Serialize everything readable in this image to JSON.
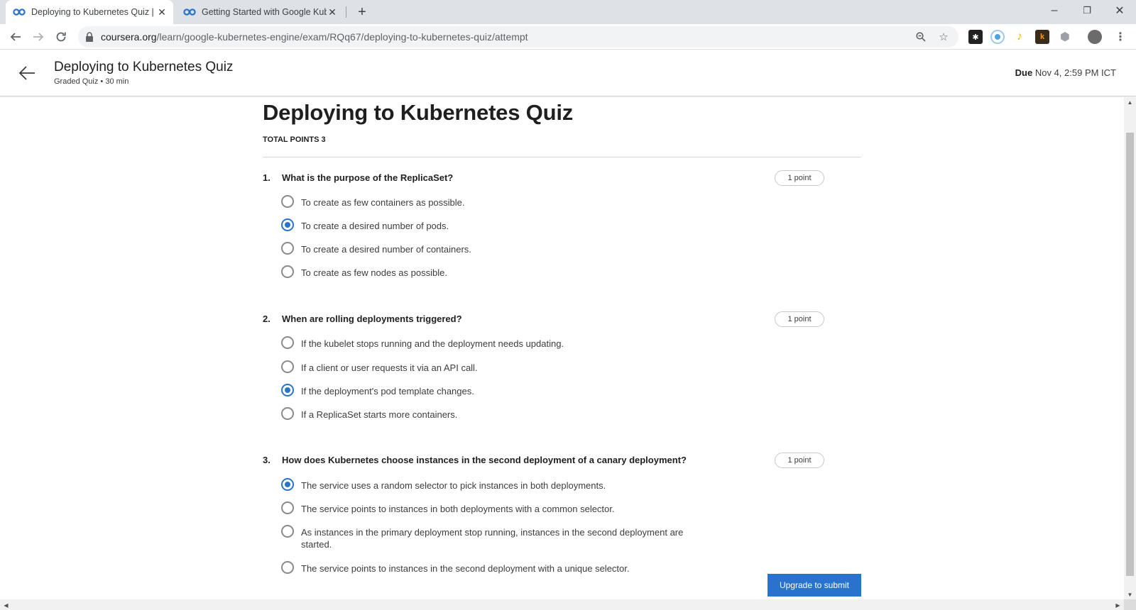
{
  "browser": {
    "tabs": [
      {
        "title": "Deploying to Kubernetes Quiz | C",
        "active": true
      },
      {
        "title": "Getting Started with Google Kub",
        "active": false
      }
    ],
    "url_host": "coursera.org",
    "url_path": "/learn/google-kubernetes-engine/exam/RQq67/deploying-to-kubernetes-quiz/attempt",
    "window_controls": {
      "minimize": "–",
      "restore": "❐",
      "close": "✕"
    },
    "extensions": [
      "ext-dark",
      "ext-blue-circle",
      "ext-yellow-key",
      "ext-orange-k",
      "ext-gray-hex"
    ]
  },
  "header": {
    "title": "Deploying to Kubernetes Quiz",
    "subtitle": "Graded Quiz • 30 min",
    "due_label": "Due",
    "due_value": "Nov 4, 2:59 PM ICT"
  },
  "quiz": {
    "title": "Deploying to Kubernetes Quiz",
    "total_points": "TOTAL POINTS 3",
    "questions": [
      {
        "number": "1.",
        "text": "What is the purpose of the ReplicaSet?",
        "points": "1 point",
        "options": [
          {
            "label": "To create as few containers as possible.",
            "checked": false
          },
          {
            "label": "To create a desired number of pods.",
            "checked": true
          },
          {
            "label": "To create a desired number of containers.",
            "checked": false
          },
          {
            "label": "To create as few nodes as possible.",
            "checked": false
          }
        ]
      },
      {
        "number": "2.",
        "text": "When are rolling deployments triggered?",
        "points": "1 point",
        "options": [
          {
            "label": "If the kubelet stops running and the deployment needs updating.",
            "checked": false
          },
          {
            "label": "If a client or user requests it via an API call.",
            "checked": false
          },
          {
            "label": "If the deployment's pod template changes.",
            "checked": true
          },
          {
            "label": "If a ReplicaSet starts more containers.",
            "checked": false
          }
        ]
      },
      {
        "number": "3.",
        "text": "How does Kubernetes choose instances in the second deployment of a canary deployment?",
        "points": "1 point",
        "options": [
          {
            "label": "The service uses a random selector to pick instances in both deployments.",
            "checked": true
          },
          {
            "label": "The service points to instances in both deployments with a common selector.",
            "checked": false
          },
          {
            "label": "As instances in the primary deployment stop running, instances in the second deployment are started.",
            "checked": false
          },
          {
            "label": "The service points to instances in the second deployment with a unique selector.",
            "checked": false
          }
        ]
      }
    ],
    "submit_label": "Upgrade to submit"
  },
  "colors": {
    "accent": "#2a73cc",
    "coursera_logo": "#2a73cc"
  }
}
